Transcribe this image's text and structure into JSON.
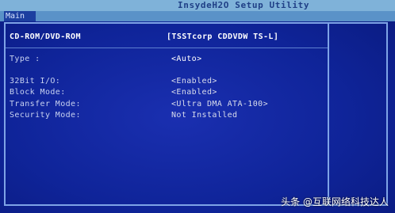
{
  "app": {
    "title": "InsydeH2O Setup Utility"
  },
  "menu": {
    "active_tab": "Main"
  },
  "device": {
    "name": "CD-ROM/DVD-ROM",
    "model": "[TSSTcorp CDDVDW TS-L]"
  },
  "settings": [
    {
      "label": "Type :",
      "value": "<Auto>"
    },
    {
      "label": "32Bit I/O:",
      "value": "<Enabled>"
    },
    {
      "label": "Block Mode:",
      "value": "<Enabled>"
    },
    {
      "label": "Transfer Mode:",
      "value": "<Ultra DMA ATA-100>"
    },
    {
      "label": "Security Mode:",
      "value": "Not Installed"
    }
  ],
  "watermark": {
    "text": "头条 @互联网络科技达人"
  }
}
